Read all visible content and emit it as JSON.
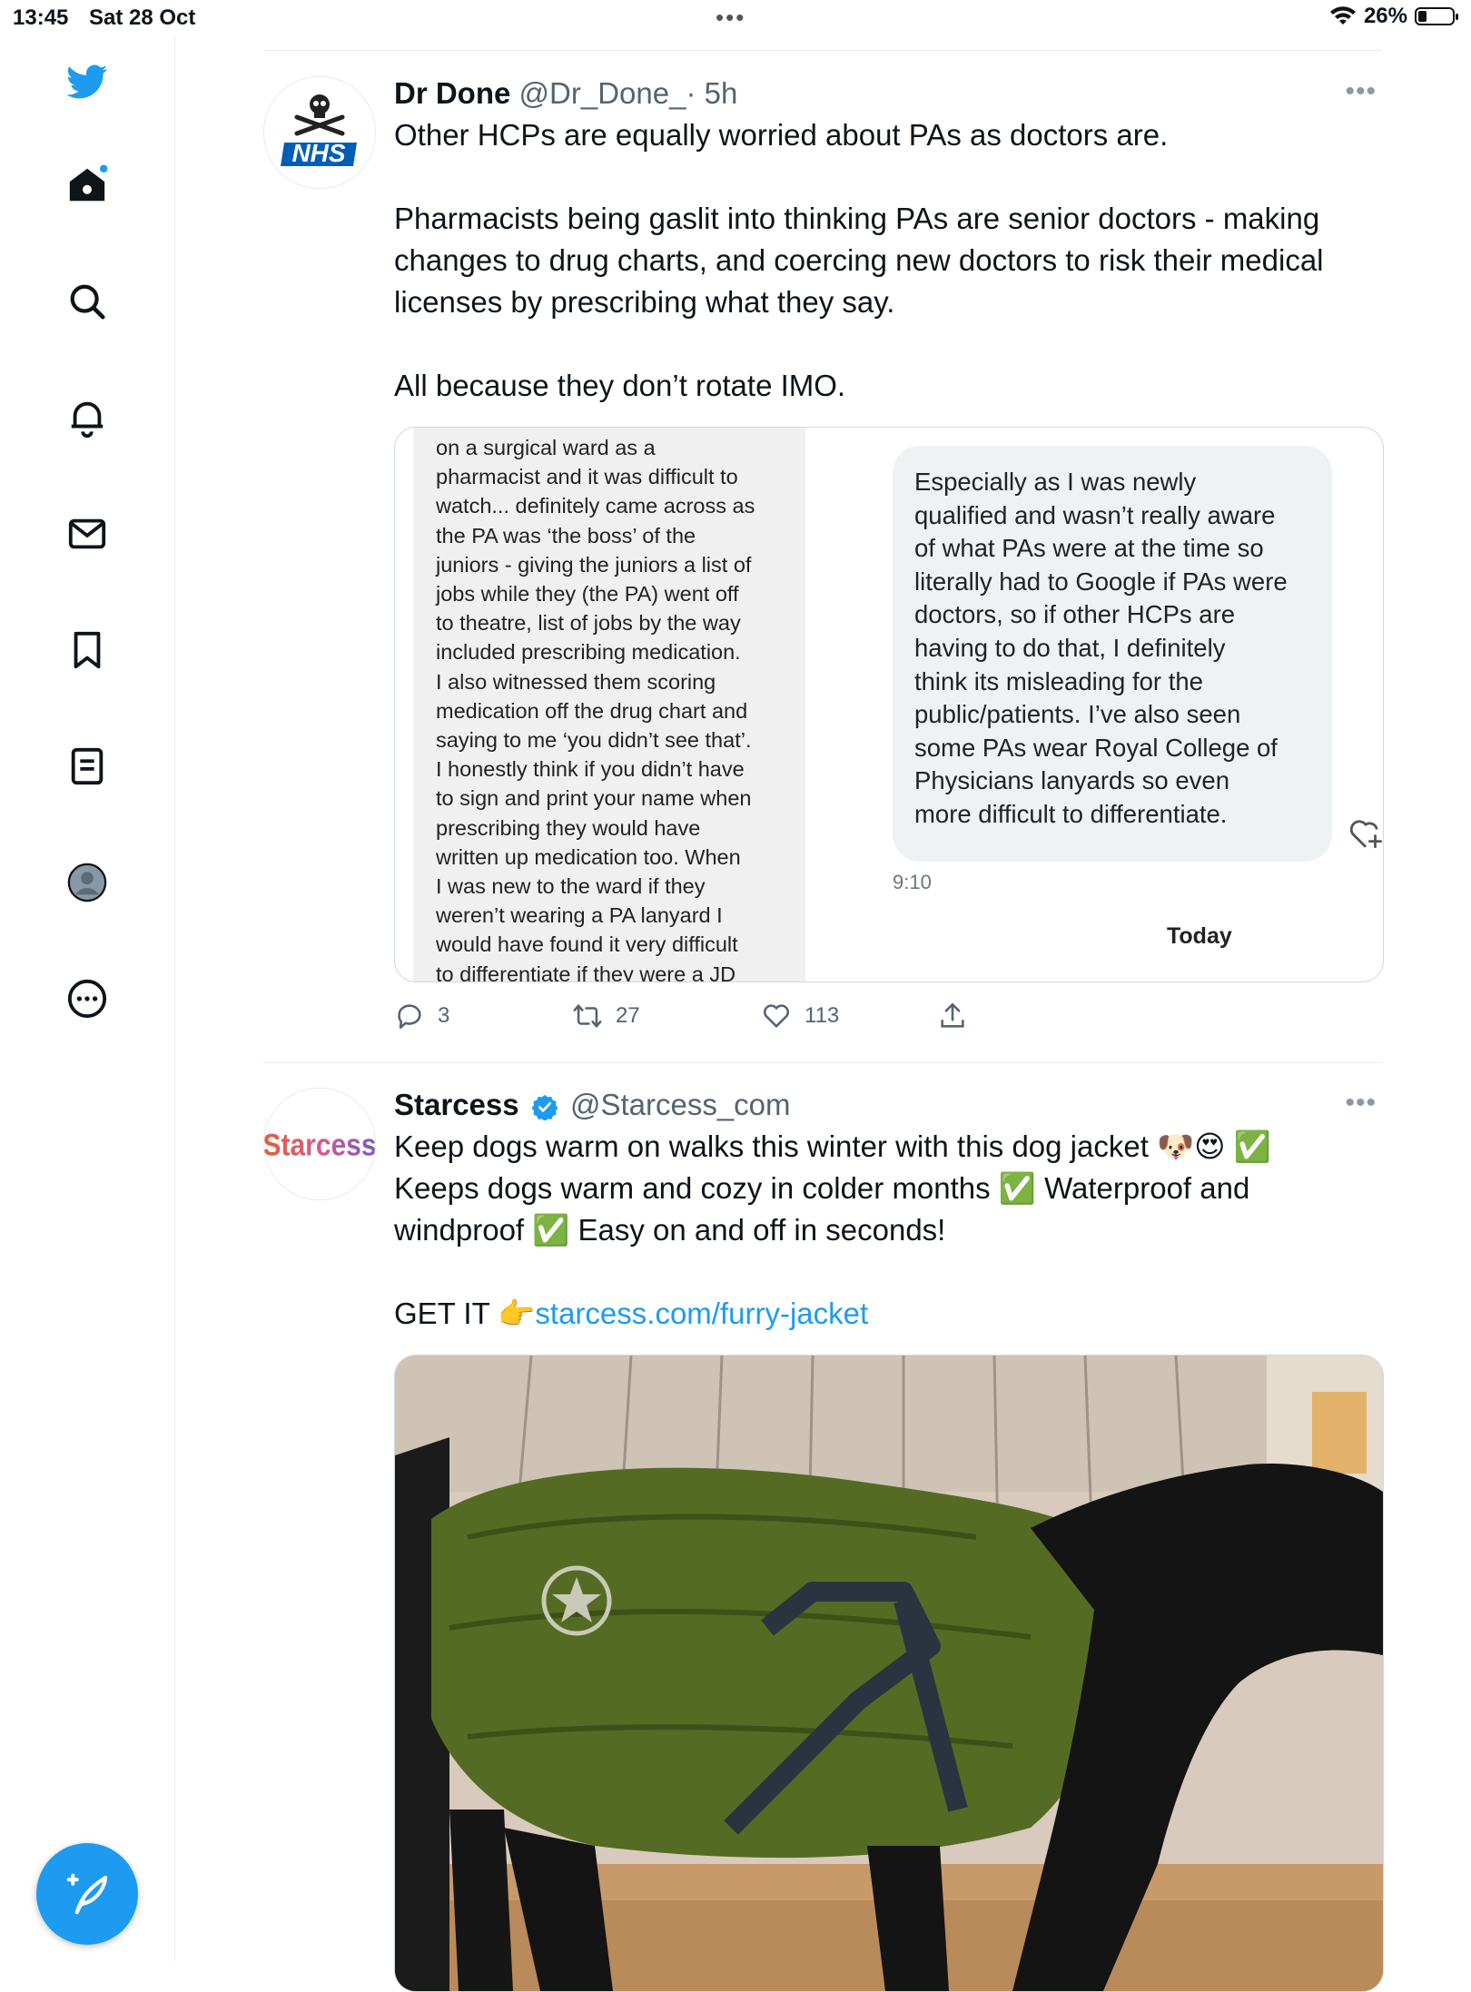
{
  "status_bar": {
    "time": "13:45",
    "date": "Sat 28 Oct",
    "battery": "26%",
    "battery_level": 0.26
  },
  "sidebar": {
    "items": [
      {
        "name": "twitter-logo-icon"
      },
      {
        "name": "home-icon",
        "has_notification_dot": true
      },
      {
        "name": "search-icon"
      },
      {
        "name": "notifications-icon"
      },
      {
        "name": "messages-icon"
      },
      {
        "name": "bookmarks-icon"
      },
      {
        "name": "lists-icon"
      },
      {
        "name": "profile-icon"
      },
      {
        "name": "more-icon"
      }
    ],
    "compose_icon": "compose-tweet-icon"
  },
  "tweets": [
    {
      "name": "Dr Done",
      "handle": "@Dr_Done_",
      "time": "· 5h",
      "avatar_text": "NHS",
      "text": [
        "Other HCPs are equally worried about PAs as doctors are.",
        "Pharmacists being gaslit into thinking PAs are senior doctors - making changes to drug charts, and coercing new doctors to risk their medical licenses by prescribing what they say.",
        "All because they don’t rotate IMO."
      ],
      "media": {
        "left_text": "on a surgical ward as a\npharmacist and it was difficult to\nwatch... definitely came across as\nthe PA was ‘the boss’ of the\njuniors - giving the juniors a list of\njobs while they (the PA) went off\nto theatre, list of jobs by the way\nincluded prescribing medication.\nI also witnessed them scoring\nmedication off the drug chart and\nsaying to me ‘you didn’t see that’.\nI honestly think if you didn’t have\nto sign and print your name when\nprescribing they would have\nwritten up medication too. When\nI was new to the ward if they\nweren’t wearing a PA lanyard I\nwould have found it very difficult\nto differentiate if they were a JD",
        "bubble_text": "Especially as I was newly\nqualified and wasn’t really aware\nof what PAs were at the time so\nliterally had to Google if PAs were\ndoctors, so if other HCPs are\nhaving to do that, I definitely\nthink its misleading for the\npublic/patients. I’ve also seen\nsome PAs wear Royal College of\nPhysicians lanyards so even\nmore difficult to differentiate.",
        "bubble_time": "9:10",
        "day_label": "Today"
      },
      "actions": {
        "replies": "3",
        "retweets": "27",
        "likes": "113"
      }
    },
    {
      "name": "Starcess",
      "handle": "@Starcess_com",
      "avatar_text": "Starcess",
      "verified": true,
      "text_line1": "Keep dogs warm on walks this winter with this dog jacket 🐶😍 ✅",
      "text_line2": "Keeps dogs warm and cozy in colder months ✅ Waterproof and",
      "text_line3": "windproof ✅ Easy on and off in seconds!",
      "cta_prefix": "GET IT 👉",
      "link": "starcess.com/furry-jacket"
    }
  ],
  "colors": {
    "accent": "#1d9bf0",
    "text": "#0f1419",
    "secondary": "#536471",
    "border": "#cfd9de"
  }
}
